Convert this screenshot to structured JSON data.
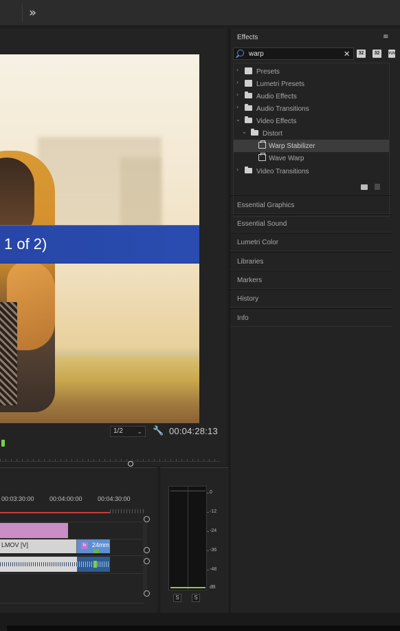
{
  "topbar": {
    "overflow_glyph": "»"
  },
  "monitor": {
    "caption_text": "1 of 2)",
    "resolution": "1/2",
    "timecode": "00:04:28:13"
  },
  "transport": {
    "icons": [
      "export-frame-icon",
      "camera-icon",
      "safe-margins-icon",
      "compare-icon",
      "record-icon",
      "vr-icon",
      "add-icon"
    ],
    "plus_glyph": "+"
  },
  "timeline": {
    "ruler_labels": [
      "00:03:30:00",
      "00:04:00:00",
      "00:04:30:00"
    ],
    "video_clip_label": "LMOV [V]",
    "blue_clip_label": "24mm",
    "fx_badge": "fx"
  },
  "meters": {
    "db_labels": [
      "0",
      "-12",
      "-24",
      "-36",
      "-48",
      "dB"
    ],
    "solo_labels": [
      "S",
      "S"
    ]
  },
  "effects": {
    "title": "Effects",
    "menu_glyph": "≡",
    "search_value": "warp",
    "toolbar_icons": [
      "accelerated-effects-icon",
      "32bit-effects-icon",
      "yuv-effects-icon"
    ],
    "toolbar_labels": [
      "32",
      "32",
      "YUV"
    ],
    "tree": [
      {
        "label": "Presets",
        "icon": "preset-bin-icon",
        "expanded": false,
        "depth": 0
      },
      {
        "label": "Lumetri Presets",
        "icon": "preset-bin-icon",
        "expanded": false,
        "depth": 0
      },
      {
        "label": "Audio Effects",
        "icon": "folder-icon",
        "expanded": false,
        "depth": 0
      },
      {
        "label": "Audio Transitions",
        "icon": "folder-icon",
        "expanded": false,
        "depth": 0
      },
      {
        "label": "Video Effects",
        "icon": "folder-icon",
        "expanded": true,
        "depth": 0
      },
      {
        "label": "Distort",
        "icon": "folder-icon",
        "expanded": true,
        "depth": 1
      },
      {
        "label": "Warp Stabilizer",
        "icon": "effect-icon",
        "selected": true,
        "depth": 2
      },
      {
        "label": "Wave Warp",
        "icon": "effect-icon",
        "depth": 2
      },
      {
        "label": "Video Transitions",
        "icon": "folder-icon",
        "expanded": false,
        "depth": 0
      }
    ],
    "sections": [
      "Essential Graphics",
      "Essential Sound",
      "Lumetri Color",
      "Libraries",
      "Markers",
      "History",
      "Info"
    ]
  },
  "colors": {
    "caption_bar": "#2a4cb0",
    "record": "#c22a2a",
    "playhead_marker": "#7ad042",
    "timeline_redline": "#c93b3b",
    "clip_pink": "#c98ec5",
    "clip_blue": "#5e8fd3",
    "search_icon": "#5b8bd6"
  }
}
